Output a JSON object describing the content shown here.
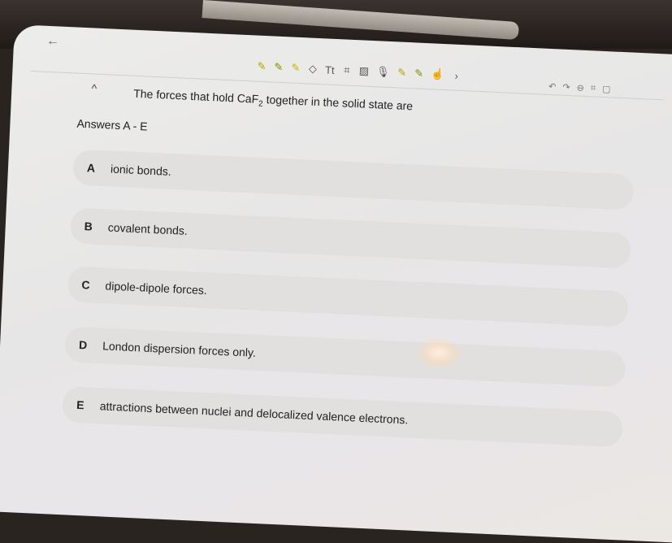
{
  "nav": {
    "back_icon": "←"
  },
  "toolbar": {
    "tools": [
      "pen-icon",
      "pen-icon",
      "marker-icon",
      "eraser-icon",
      "text-icon",
      "shapes-icon",
      "image-icon",
      "mic-icon",
      "pen-icon",
      "pen-icon",
      "hand-icon",
      "chevron-right-icon"
    ],
    "glyphs": [
      "✎",
      "✎",
      "✎",
      "◇",
      "Tt",
      "⌗",
      "▨",
      "🎙",
      "✎",
      "✎",
      "☝",
      "›"
    ],
    "right_glyphs": [
      "↶",
      "↷",
      "⊖",
      "⌗",
      "▢"
    ]
  },
  "question": {
    "collapse_glyph": "^",
    "text_before": "The forces that hold CaF",
    "subscript": "2",
    "text_after": " together in the solid state are"
  },
  "answers_label": "Answers A - E",
  "options": [
    {
      "letter": "A",
      "text": "ionic bonds."
    },
    {
      "letter": "B",
      "text": "covalent bonds."
    },
    {
      "letter": "C",
      "text": "dipole-dipole forces."
    },
    {
      "letter": "D",
      "text": "London dispersion forces only."
    },
    {
      "letter": "E",
      "text": "attractions between nuclei and delocalized valence electrons."
    }
  ],
  "colors": {
    "accent_pen": "#b7a600",
    "option_bg": "#e1dede",
    "text": "#222222"
  }
}
